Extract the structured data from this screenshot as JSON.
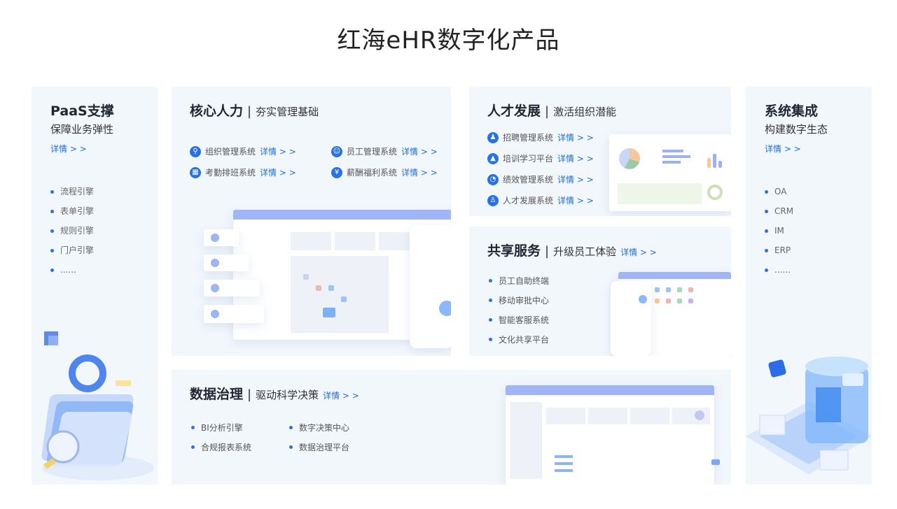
{
  "page": {
    "title": "红海eHR数字化产品"
  },
  "paas": {
    "title": "PaaS支撑",
    "subtitle": "保障业务弹性",
    "detail": "详情 > >",
    "items": [
      "流程引擎",
      "表单引擎",
      "规则引擎",
      "门户引擎",
      "......"
    ]
  },
  "core": {
    "title": "核心人力",
    "separator": "|",
    "subtitle": "夯实管理基础",
    "systems": [
      {
        "label": "组织管理系统",
        "detail": "详情 > >",
        "icon": "org-chart-icon"
      },
      {
        "label": "员工管理系统",
        "detail": "详情 > >",
        "icon": "user-icon"
      },
      {
        "label": "考勤排班系统",
        "detail": "详情 > >",
        "icon": "calendar-icon"
      },
      {
        "label": "薪酬福利系统",
        "detail": "详情 > >",
        "icon": "yen-coin-icon"
      }
    ]
  },
  "talent": {
    "title": "人才发展",
    "separator": "|",
    "subtitle": "激活组织潜能",
    "systems": [
      {
        "label": "招聘管理系统",
        "detail": "详情 > >",
        "icon": "recruit-icon"
      },
      {
        "label": "培训学习平台",
        "detail": "详情 > >",
        "icon": "graduation-cap-icon"
      },
      {
        "label": "绩效管理系统",
        "detail": "详情 > >",
        "icon": "pie-chart-icon"
      },
      {
        "label": "人才发展系统",
        "detail": "详情 > >",
        "icon": "person-growth-icon"
      }
    ]
  },
  "shared": {
    "title": "共享服务",
    "separator": "|",
    "subtitle": "升级员工体验",
    "detail": "详情 > >",
    "items": [
      "员工自助终端",
      "移动审批中心",
      "智能客服系统",
      "文化共享平台"
    ]
  },
  "data_gov": {
    "title": "数据治理",
    "separator": "|",
    "subtitle": "驱动科学决策",
    "detail": "详情 > >",
    "items": [
      "BI分析引擎",
      "数字决策中心",
      "合规报表系统",
      "数据治理平台"
    ]
  },
  "integration": {
    "title": "系统集成",
    "subtitle": "构建数字生态",
    "detail": "详情 > >",
    "items": [
      "OA",
      "CRM",
      "IM",
      "ERP",
      "......"
    ]
  },
  "colors": {
    "accent": "#1d6de0",
    "card_bg": "#f2f7fc",
    "title": "#1f2633"
  }
}
